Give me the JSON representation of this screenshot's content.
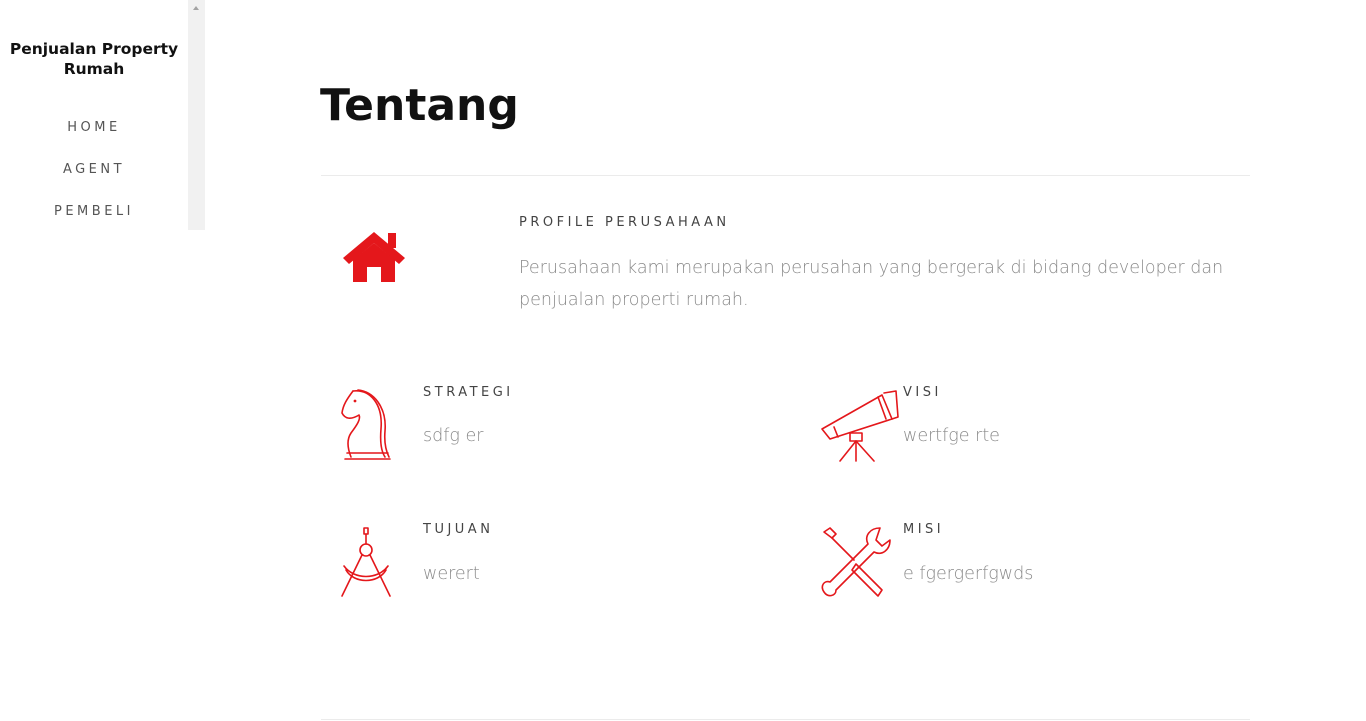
{
  "sidebar": {
    "brand": "Penjualan Property Rumah",
    "nav": [
      "HOME",
      "AGENT",
      "PEMBELI"
    ]
  },
  "main": {
    "title": "Tentang",
    "profile": {
      "title": "PROFILE PERUSAHAAN",
      "text": "Perusahaan kami merupakan perusahan yang bergerak di bidang developer dan penjualan properti rumah."
    },
    "features": [
      {
        "title": "STRATEGI",
        "text": "sdfg er",
        "icon": "chess-knight-icon"
      },
      {
        "title": "VISI",
        "text": "wertfge rte",
        "icon": "telescope-icon"
      },
      {
        "title": "TUJUAN",
        "text": "werert",
        "icon": "compass-icon"
      },
      {
        "title": "MISI",
        "text": "e fgergerfgwds",
        "icon": "tools-icon"
      }
    ]
  },
  "colors": {
    "accent": "#e4171b",
    "heading": "#111111",
    "body_text": "#8a8a8a",
    "nav_text": "#555555"
  }
}
